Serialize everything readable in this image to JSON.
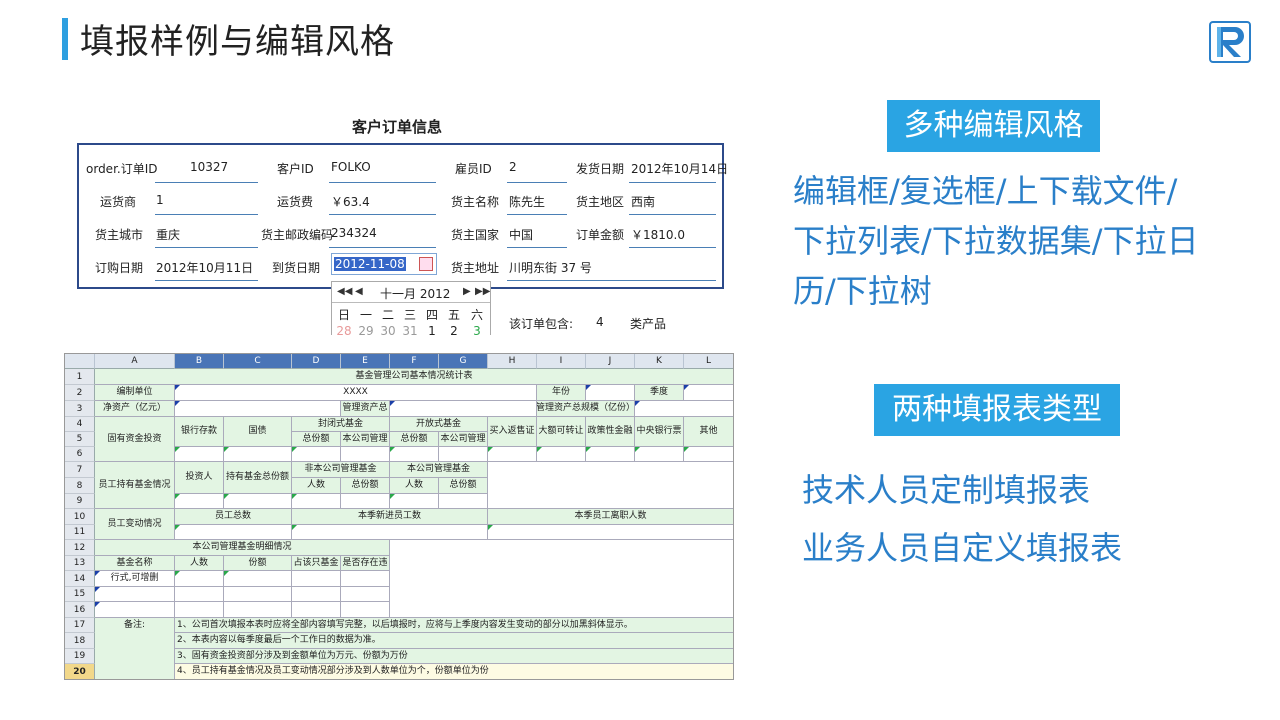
{
  "page": {
    "title": "填报样例与编辑风格"
  },
  "logo": {
    "icon": "R-logo-icon"
  },
  "right": {
    "badge1": "多种编辑风格",
    "styles_line1": "编辑框/复选框/上下载文件/",
    "styles_line2": "下拉列表/下拉数据集/下拉日",
    "styles_line3": "历/下拉树",
    "badge2": "两种填报表类型",
    "type1": "技术人员定制填报表",
    "type2": "业务人员自定义填报表"
  },
  "form": {
    "title": "客户订单信息",
    "row1": {
      "l1": "order.订单ID",
      "v1": "10327",
      "l2": "客户ID",
      "v2": "FOLKO",
      "l3": "雇员ID",
      "v3": "2",
      "l4": "发货日期",
      "v4": "2012年10月14日"
    },
    "row2": {
      "l1": "运货商",
      "v1": "1",
      "l2": "运货费",
      "v2": "￥63.4",
      "l3": "货主名称",
      "v3": "陈先生",
      "l4": "货主地区",
      "v4": "西南"
    },
    "row3": {
      "l1": "货主城市",
      "v1": "重庆",
      "l2": "货主邮政编码",
      "v2": "234324",
      "l3": "货主国家",
      "v3": "中国",
      "l4": "订单金额",
      "v4": "￥1810.0"
    },
    "row4": {
      "l1": "订购日期",
      "v1": "2012年10月11日",
      "l2": "到货日期",
      "v2": "2012-11-08",
      "l3": "货主地址",
      "v3": "川明东街 37 号"
    },
    "summary": {
      "label": "该订单包含:",
      "count": "4",
      "unit": "类产品"
    },
    "calendar": {
      "prev_year": "◀◀",
      "prev_month": "◀",
      "month": "十一月 2012",
      "next_month": "▶",
      "next_year": "▶▶",
      "weekdays": [
        "日",
        "一",
        "二",
        "三",
        "四",
        "五",
        "六"
      ],
      "days": [
        "28",
        "29",
        "30",
        "31",
        "1",
        "2",
        "3"
      ]
    }
  },
  "sheet": {
    "columns": [
      "A",
      "B",
      "C",
      "D",
      "E",
      "F",
      "G",
      "H",
      "I",
      "J",
      "K",
      "L"
    ],
    "rows": [
      "1",
      "2",
      "3",
      "4",
      "5",
      "6",
      "7",
      "8",
      "9",
      "10",
      "11",
      "12",
      "13",
      "14",
      "15",
      "16",
      "17",
      "18",
      "19",
      "20"
    ],
    "title": "基金管理公司基本情况统计表",
    "org_label": "编制单位",
    "org_value": "XXXX",
    "year_label": "年份",
    "quarter_label": "季度",
    "net_asset": "净资产（亿元）",
    "mgmt_total": "管理资产总",
    "mgmt_scale": "管理资产总规模（亿份）",
    "fixed_invest": "固有资金投资",
    "bank_deposit": "银行存款",
    "bond": "国债",
    "closed_fund": "封闭式基金",
    "open_fund": "开放式基金",
    "buy_repo": "买入返售证",
    "transfer_deposit": "大额可转让",
    "policy_finance": "政策性金融",
    "central_bill": "中央银行票",
    "other": "其他",
    "total_shares": "总份额",
    "own_mgmt": "本公司管理",
    "staff_fund": "员工持有基金情况",
    "investors": "投资人",
    "fund_total_shares": "持有基金总份额",
    "non_own_mgmt_fund": "非本公司管理基金",
    "own_mgmt_fund": "本公司管理基金",
    "people": "人数",
    "staff_change": "员工变动情况",
    "staff_total": "员工总数",
    "new_staff": "本季新进员工数",
    "leave_staff": "本季员工离职人数",
    "detail_title": "本公司管理基金明细情况",
    "fund_name": "基金名称",
    "shares": "份额",
    "ratio": "占该只基金",
    "hold": "是否存在违",
    "row_hint": "行式,可增删",
    "remark_label": "备注:",
    "remark1": "1、公司首次填报本表时应将全部内容填写完整，以后填报时，应将与上季度内容发生变动的部分以加黑斜体显示。",
    "remark2": "2、本表内容以每季度最后一个工作日的数据为准。",
    "remark3": "3、固有资金投资部分涉及到金额单位为万元、份额为万份",
    "remark4": "4、员工持有基金情况及员工变动情况部分涉及到人数单位为个，份额单位为份"
  },
  "colors": {
    "accent": "#2aa4e3",
    "text_blue": "#2a7fc9",
    "form_border": "#2c4a8a",
    "sheet_green": "#e3f5e3"
  }
}
